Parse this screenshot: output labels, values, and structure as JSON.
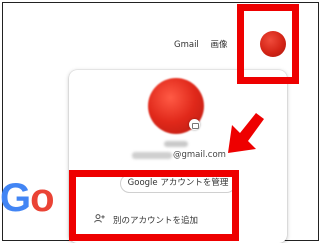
{
  "header": {
    "gmail_label": "Gmail",
    "images_label": "画像"
  },
  "account_panel": {
    "email_suffix": "@gmail.com",
    "manage_account_button": "Google アカウントを管理",
    "add_account_label": "別のアカウントを追加"
  },
  "logo": {
    "text_g": "G",
    "text_o": "o",
    "brand_blue": "#4285f4",
    "brand_red": "#ea4335"
  },
  "annotation_color": "#ee0000"
}
